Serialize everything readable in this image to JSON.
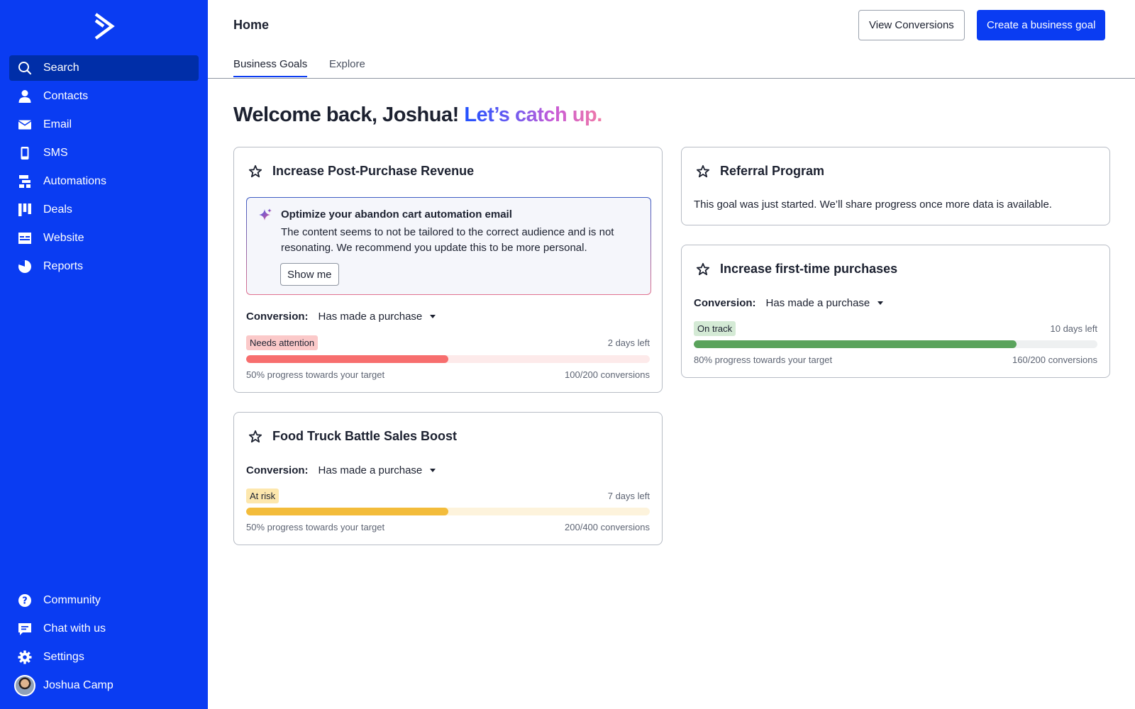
{
  "colors": {
    "brand": "#0a3cf2",
    "sidebar_active": "#002ea8",
    "needs_attention": "#f76e6e",
    "at_risk": "#f3bc3b",
    "on_track": "#5aa35c"
  },
  "sidebar": {
    "logo": "chevron-arrow-logo",
    "items": [
      {
        "label": "Search",
        "icon": "search-icon",
        "active": true
      },
      {
        "label": "Contacts",
        "icon": "person-icon"
      },
      {
        "label": "Email",
        "icon": "envelope-icon"
      },
      {
        "label": "SMS",
        "icon": "phone-icon"
      },
      {
        "label": "Automations",
        "icon": "automation-icon"
      },
      {
        "label": "Deals",
        "icon": "deals-icon"
      },
      {
        "label": "Website",
        "icon": "website-icon"
      },
      {
        "label": "Reports",
        "icon": "pie-chart-icon"
      }
    ],
    "bottom_items": [
      {
        "label": "Community",
        "icon": "help-icon"
      },
      {
        "label": "Chat with us",
        "icon": "chat-icon"
      },
      {
        "label": "Settings",
        "icon": "gear-icon"
      },
      {
        "label": "Joshua Camp",
        "icon": "avatar"
      }
    ]
  },
  "header": {
    "title": "Home",
    "view_conversions": "View Conversions",
    "create_goal": "Create a business goal"
  },
  "tabs": [
    {
      "label": "Business Goals",
      "active": true
    },
    {
      "label": "Explore"
    }
  ],
  "welcome": {
    "greeting": "Welcome back, Joshua!",
    "tagline": "Let’s catch up."
  },
  "goals": {
    "post_purchase": {
      "title": "Increase Post-Purchase Revenue",
      "suggestion_title": "Optimize your abandon cart automation email",
      "suggestion_text": "The content seems to not be tailored to the correct audience and is not resonating. We recommend you update this to be more personal.",
      "suggestion_button": "Show me",
      "conversion_label": "Conversion:",
      "conversion_value": "Has made a purchase",
      "status": "Needs attention",
      "days_left": "2 days left",
      "progress": 0.5,
      "progress_text": "50% progress towards your target",
      "conversions": "100/200 conversions"
    },
    "referral": {
      "title": "Referral Program",
      "description": "This goal was just started. We’ll share progress once more data is available."
    },
    "first_time": {
      "title": "Increase first-time purchases",
      "conversion_label": "Conversion:",
      "conversion_value": "Has made a purchase",
      "status": "On track",
      "days_left": "10 days left",
      "progress": 0.8,
      "progress_text": "80% progress towards your target",
      "conversions": "160/200 conversions"
    },
    "food_truck": {
      "title": "Food Truck Battle Sales Boost",
      "conversion_label": "Conversion:",
      "conversion_value": "Has made a purchase",
      "status": "At risk",
      "days_left": "7 days left",
      "progress": 0.5,
      "progress_text": "50% progress towards your target",
      "conversions": "200/400 conversions"
    }
  }
}
